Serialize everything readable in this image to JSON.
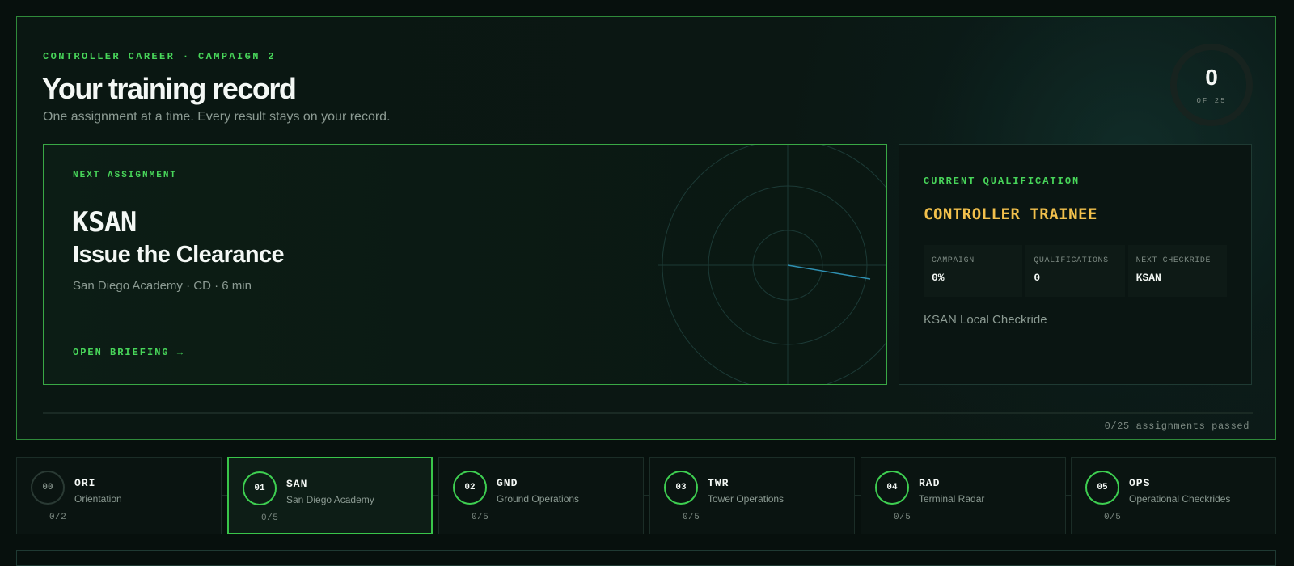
{
  "hero": {
    "kicker": "CONTROLLER CAREER · CAMPAIGN 2",
    "title": "Your training record",
    "subtitle": "One assignment at a time. Every result stays on your record.",
    "progress_ring": {
      "value": "0",
      "of_label": "OF 25",
      "fraction": 0
    }
  },
  "next_assignment": {
    "label": "NEXT ASSIGNMENT",
    "airport": "KSAN",
    "title": "Issue the Clearance",
    "meta": "San Diego Academy · CD · 6 min",
    "action": "OPEN BRIEFING →"
  },
  "qualification": {
    "label": "CURRENT QUALIFICATION",
    "rank": "CONTROLLER TRAINEE",
    "stats": [
      {
        "key": "CAMPAIGN",
        "value": "0%"
      },
      {
        "key": "QUALIFICATIONS",
        "value": "0"
      },
      {
        "key": "NEXT CHECKRIDE",
        "value": "KSAN"
      }
    ],
    "next_checkride": "KSAN Local Checkride"
  },
  "summary": {
    "passed": "0/25 assignments passed"
  },
  "modules": [
    {
      "num": "00",
      "code": "ORI",
      "name": "Orientation",
      "count": "0/2",
      "active": false
    },
    {
      "num": "01",
      "code": "SAN",
      "name": "San Diego Academy",
      "count": "0/5",
      "active": true
    },
    {
      "num": "02",
      "code": "GND",
      "name": "Ground Operations",
      "count": "0/5",
      "active": false
    },
    {
      "num": "03",
      "code": "TWR",
      "name": "Tower Operations",
      "count": "0/5",
      "active": false
    },
    {
      "num": "04",
      "code": "RAD",
      "name": "Terminal Radar",
      "count": "0/5",
      "active": false
    },
    {
      "num": "05",
      "code": "OPS",
      "name": "Operational Checkrides",
      "count": "0/5",
      "active": false
    }
  ],
  "colors": {
    "accent": "#48d65a",
    "rank": "#f2c04c",
    "background": "#07100d"
  }
}
